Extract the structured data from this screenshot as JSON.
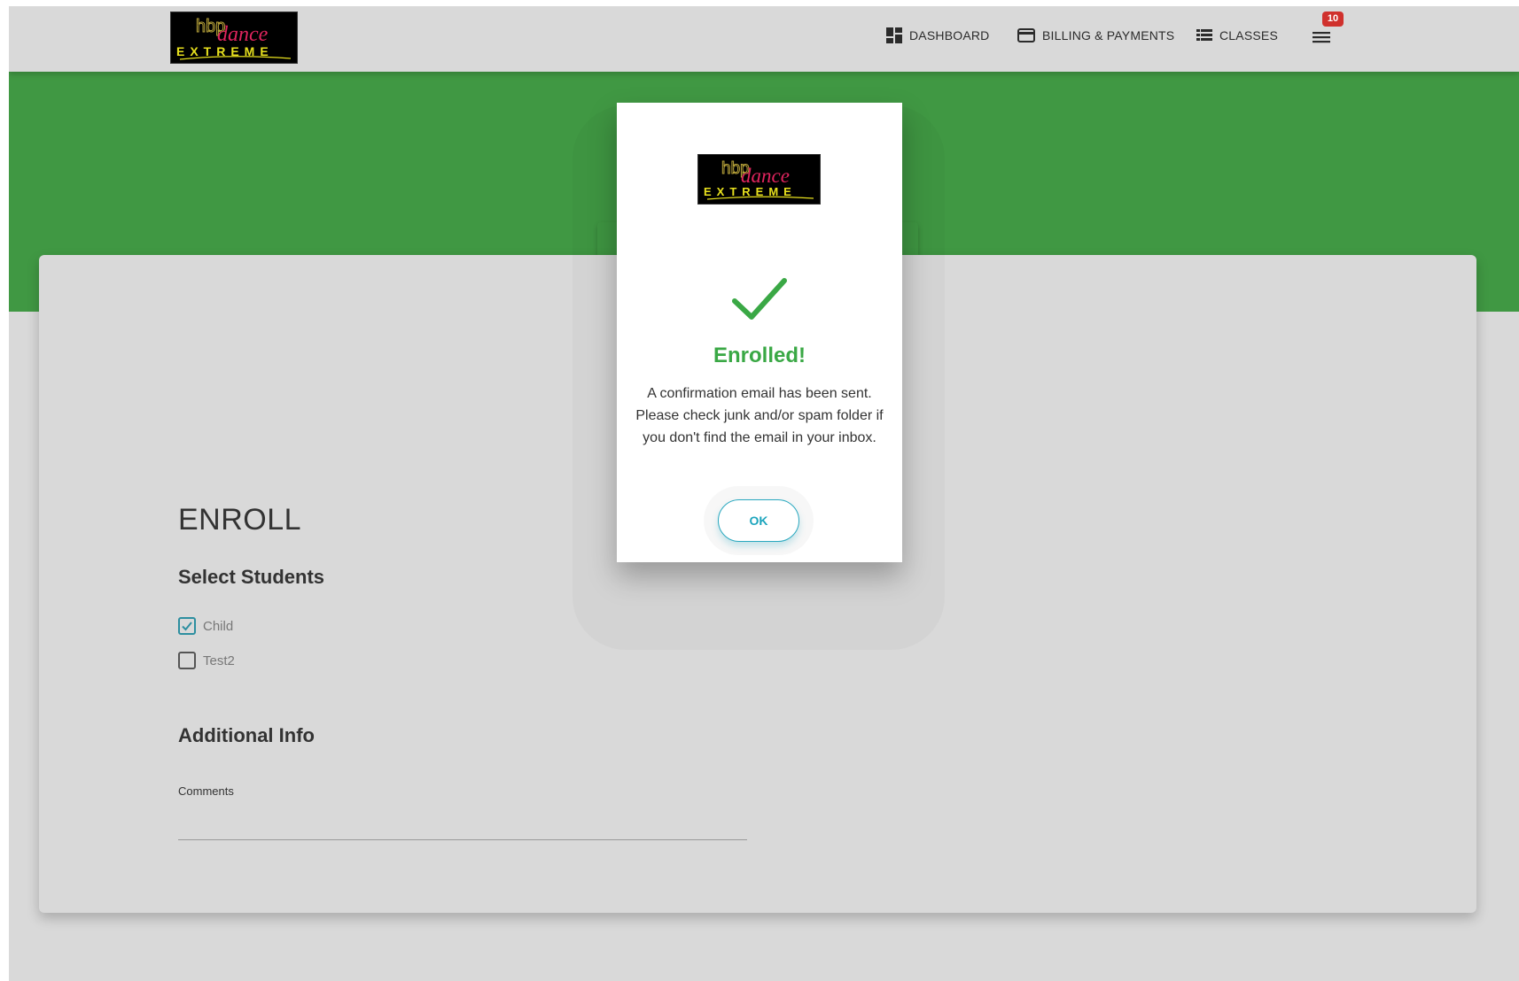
{
  "navbar": {
    "logo": {
      "brand": "dance",
      "tagline": "EXTREME",
      "mark": "hbp"
    },
    "items": [
      {
        "label": "DASHBOARD",
        "icon": "dashboard-icon"
      },
      {
        "label": "BILLING & PAYMENTS",
        "icon": "credit-card-icon"
      },
      {
        "label": "CLASSES",
        "icon": "list-icon"
      }
    ],
    "menu_icon": "hamburger-menu-icon",
    "notification_count": "10"
  },
  "page": {
    "title": "ENROLL",
    "select_students": {
      "heading": "Select Students",
      "students": [
        {
          "name": "Child",
          "checked": true
        },
        {
          "name": "Test2",
          "checked": false
        }
      ]
    },
    "additional_info": {
      "heading": "Additional Info",
      "comments_label": "Comments",
      "comments_value": ""
    }
  },
  "modal": {
    "logo": {
      "brand": "dance",
      "tagline": "EXTREME",
      "mark": "hbp"
    },
    "icon": "checkmark-icon",
    "title": "Enrolled!",
    "message": "A confirmation email has been sent. Please check junk and/or spam folder if you don't find the email in your inbox.",
    "ok_label": "OK"
  },
  "colors": {
    "brand_green": "#409843",
    "success_green": "#3aa845",
    "accent_teal": "#1da5bd",
    "badge_red": "#d0312d",
    "background_gray": "#d9d9d9"
  }
}
